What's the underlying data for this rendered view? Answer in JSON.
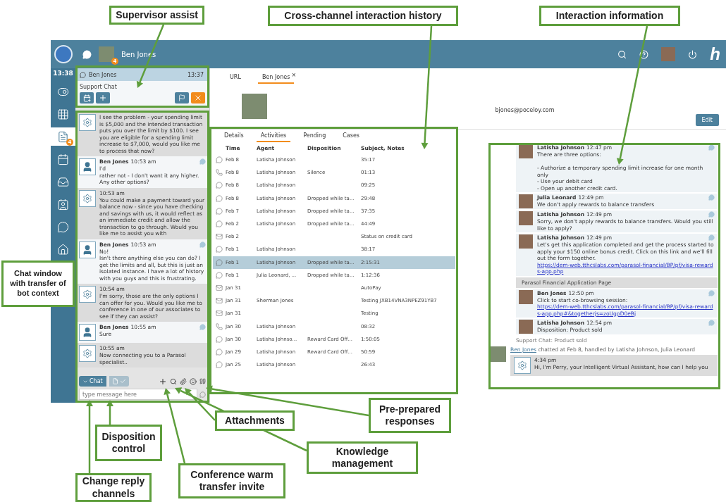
{
  "top_bar": {
    "user_name": "Ben Jones",
    "notification_count": "4",
    "logo": "h"
  },
  "rail": {
    "time": "13:38",
    "items": [
      {
        "kind": "toggle",
        "selected": false
      },
      {
        "kind": "apps",
        "selected": false
      },
      {
        "kind": "documents",
        "selected": true,
        "badge": "4"
      },
      {
        "kind": "calendar",
        "selected": false
      },
      {
        "kind": "inbox",
        "selected": false
      },
      {
        "kind": "contacts",
        "selected": false
      },
      {
        "kind": "chat",
        "selected": false
      },
      {
        "kind": "home",
        "selected": false
      }
    ]
  },
  "supervisor": {
    "name": "Ben Jones",
    "time": "13:37",
    "queue": "Support Chat"
  },
  "chat": {
    "messages": [
      {
        "kind": "bot",
        "text": "I see the problem - your spending limit is $5,000 and the intended transaction puts you over the limit by $100. I see you are eligible for a spending limit increase to $7,000, would you like me to process that now?"
      },
      {
        "kind": "user",
        "name": "Ben Jones",
        "time": "10:53 am",
        "text": "I'd\nrather not - I don't want it any higher. Any other options?"
      },
      {
        "kind": "bot",
        "time": "10:53 am",
        "text": "You could make a payment toward your balance now - since you have checking and savings with us, it would reflect as an immediate credit and allow the transaction to go through. Would you like me to assist you with"
      },
      {
        "kind": "user",
        "name": "Ben Jones",
        "time": "10:53 am",
        "text": "No!\nIsn't there anything else you can do? I get the limits and all, but this is just an isolated instance. I have a lot of history with you guys and this is frustrating."
      },
      {
        "kind": "bot",
        "time": "10:54 am",
        "text": "I'm sorry, those are the only options I can offer for you. Would you like me to conference in one of our associates to see if they can assist?"
      },
      {
        "kind": "user",
        "name": "Ben Jones",
        "time": "10:55 am",
        "text": "Sure"
      },
      {
        "kind": "bot",
        "time": "10:55 am",
        "text": "Now connecting you to a Parasol specialist.."
      }
    ],
    "reply_channel": "Chat",
    "placeholder": "type message here"
  },
  "profile": {
    "tabs": [
      {
        "label": "URL",
        "selected": false
      },
      {
        "label": "Ben Jones",
        "selected": true,
        "close": "×"
      }
    ],
    "email": "bjones@poceloy.com",
    "edit_button": "Edit"
  },
  "activity_tabs": [
    {
      "label": "Details",
      "selected": false
    },
    {
      "label": "Activities",
      "selected": true
    },
    {
      "label": "Pending",
      "selected": false
    },
    {
      "label": "Cases",
      "selected": false
    }
  ],
  "history": {
    "columns": [
      "Time",
      "Agent",
      "Disposition",
      "Subject, Notes"
    ],
    "rows": [
      {
        "kind": "chat",
        "time": "Feb 8",
        "agent": "Latisha Johnson",
        "disposition": "",
        "subject": "35:17",
        "selected": false
      },
      {
        "kind": "phone",
        "time": "Feb 8",
        "agent": "Latisha Johnson",
        "disposition": "Silence",
        "subject": "01:13",
        "selected": false
      },
      {
        "kind": "chat",
        "time": "Feb 8",
        "agent": "Latisha Johnson",
        "disposition": "",
        "subject": "09:25",
        "selected": false
      },
      {
        "kind": "chat",
        "time": "Feb 8",
        "agent": "Latisha Johnson",
        "disposition": "Dropped while ta...",
        "subject": "29:48",
        "selected": false
      },
      {
        "kind": "chat",
        "time": "Feb 7",
        "agent": "Latisha Johnson",
        "disposition": "Dropped while ta...",
        "subject": "37:35",
        "selected": false
      },
      {
        "kind": "chat",
        "time": "Feb 2",
        "agent": "Latisha Johnson",
        "disposition": "Dropped while ta...",
        "subject": "44:49",
        "selected": false
      },
      {
        "kind": "email",
        "time": "Feb 2",
        "agent": "",
        "disposition": "",
        "subject": "Status on credit card",
        "selected": false
      },
      {
        "kind": "chat",
        "time": "Feb 1",
        "agent": "Latisha Johnson",
        "disposition": "",
        "subject": "38:17",
        "selected": false
      },
      {
        "kind": "chat",
        "time": "Feb 1",
        "agent": "Latisha Johnson",
        "disposition": "Dropped while ta...",
        "subject": "2:15:31",
        "selected": true
      },
      {
        "kind": "chat",
        "time": "Feb 1",
        "agent": "Julia Leonard, ...",
        "disposition": "Dropped while ta...",
        "subject": "1:12:36",
        "selected": false
      },
      {
        "kind": "email",
        "time": "Jan 31",
        "agent": "",
        "disposition": "",
        "subject": "AutoPay",
        "selected": false
      },
      {
        "kind": "email",
        "time": "Jan 31",
        "agent": "Sherman Jones",
        "disposition": "",
        "subject": "Testing JXB14VNA3NPEZ91YB7",
        "selected": false
      },
      {
        "kind": "email",
        "time": "Jan 31",
        "agent": "",
        "disposition": "",
        "subject": "Testing",
        "selected": false
      },
      {
        "kind": "phone",
        "time": "Jan 30",
        "agent": "Latisha Johnson",
        "disposition": "",
        "subject": "08:32",
        "selected": false
      },
      {
        "kind": "chat",
        "time": "Jan 30",
        "agent": "Latisha Johnso...",
        "disposition": "Reward Card Off...",
        "subject": "1:50:05",
        "selected": false
      },
      {
        "kind": "chat",
        "time": "Jan 29",
        "agent": "Latisha Johnson",
        "disposition": "Reward Card Off...",
        "subject": "50:59",
        "selected": false
      },
      {
        "kind": "chat",
        "time": "Jan 25",
        "agent": "Latisha Johnson",
        "disposition": "",
        "subject": "26:43",
        "selected": false
      }
    ]
  },
  "transcript": {
    "entries": [
      {
        "kind": "message",
        "name": "Latisha Johnson",
        "time": "12:47 pm",
        "text": "There are three options:\n\n - Authorize a temporary spending limit increase for one month only\n - Use your debit card\n - Open up another credit card."
      },
      {
        "kind": "message",
        "name": "Julia Leonard",
        "time": "12:49 pm",
        "text": "We don't apply rewards to balance transfers"
      },
      {
        "kind": "message",
        "name": "Latisha Johnson",
        "time": "12:49 pm",
        "text": "Sorry, we don't apply rewards to balance transfers. Would you still like to apply?"
      },
      {
        "kind": "message",
        "name": "Latisha Johnson",
        "time": "12:49 pm",
        "text": "Let's get this application completed and get the process started to apply your $150 online bonus credit. Click on this link and we'll fill out the form together.",
        "link": "https://dem-web.tthcslabs.com/parasol-financial/BP/pf/visa-rewards-app.php"
      },
      {
        "kind": "page",
        "text": "Parasol Financial Application Page"
      },
      {
        "kind": "message",
        "name": "Ben Jones",
        "time": "12:50 pm",
        "text": "Click to start co-browsing session:",
        "link": "https://dem-web.tthcslabs.com/parasol-financial/BP/pf/visa-rewards-app.php#&togetherjs=zoUgpD0eBj"
      },
      {
        "kind": "message",
        "name": "Latisha Johnson",
        "time": "12:54 pm",
        "text": "Disposition: Product sold"
      },
      {
        "kind": "note",
        "text": "Support Chat: Product sold"
      }
    ],
    "session": {
      "customer": "Ben Jones",
      "summary": "chatted at Feb 8, handled by Latisha Johnson, Julia Leonard",
      "bot_time": "4:34 pm",
      "bot_text": "Hi, I'm Perry, your Intelligent Virtual Assistant, how can I help you"
    }
  },
  "callouts": [
    {
      "text": "Supervisor assist"
    },
    {
      "text": "Cross-channel interaction history"
    },
    {
      "text": "Interaction information"
    },
    {
      "text": "Chat window with transfer of bot context"
    },
    {
      "text": "Attachments"
    },
    {
      "text": "Pre-prepared responses"
    },
    {
      "text": "Disposition control"
    },
    {
      "text": "Knowledge management"
    },
    {
      "text": "Conference warm transfer invite"
    },
    {
      "text": "Change reply channels"
    }
  ]
}
